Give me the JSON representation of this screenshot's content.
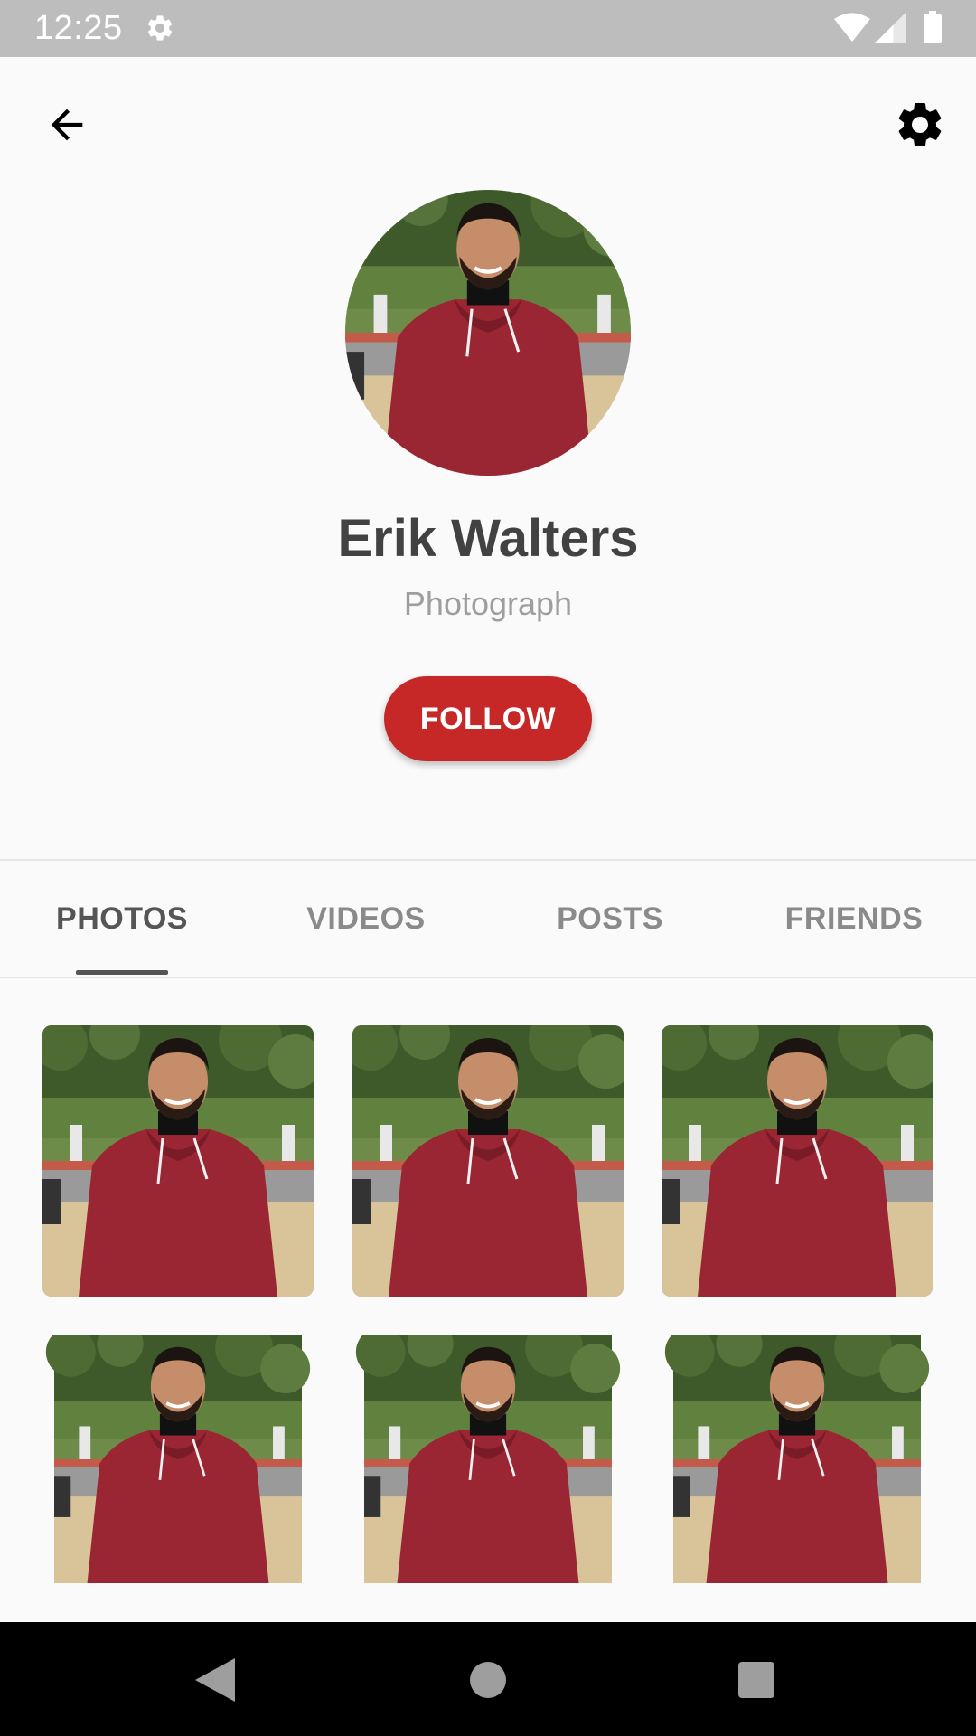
{
  "status_bar": {
    "time": "12:25",
    "icons": [
      "gear-icon",
      "wifi-icon",
      "signal-icon",
      "battery-icon"
    ]
  },
  "top_bar": {
    "back_icon": "arrow-left-icon",
    "settings_icon": "gear-icon"
  },
  "profile": {
    "name": "Erik Walters",
    "role": "Photograph",
    "follow_label": "FOLLOW"
  },
  "tabs": [
    {
      "label": "PHOTOS",
      "active": true
    },
    {
      "label": "VIDEOS",
      "active": false
    },
    {
      "label": "POSTS",
      "active": false
    },
    {
      "label": "FRIENDS",
      "active": false
    }
  ],
  "photos_count_visible": 6,
  "nav_bar": {
    "icons": [
      "back-triangle-icon",
      "home-circle-icon",
      "recents-square-icon"
    ]
  },
  "colors": {
    "accent": "#c62828",
    "status_bar": "#bdbdbd",
    "background": "#fafafa",
    "name_text": "#424242",
    "role_text": "#9e9e9e",
    "tab_active": "#555555",
    "tab_inactive": "#8a8a8a",
    "nav_bar": "#000000"
  }
}
